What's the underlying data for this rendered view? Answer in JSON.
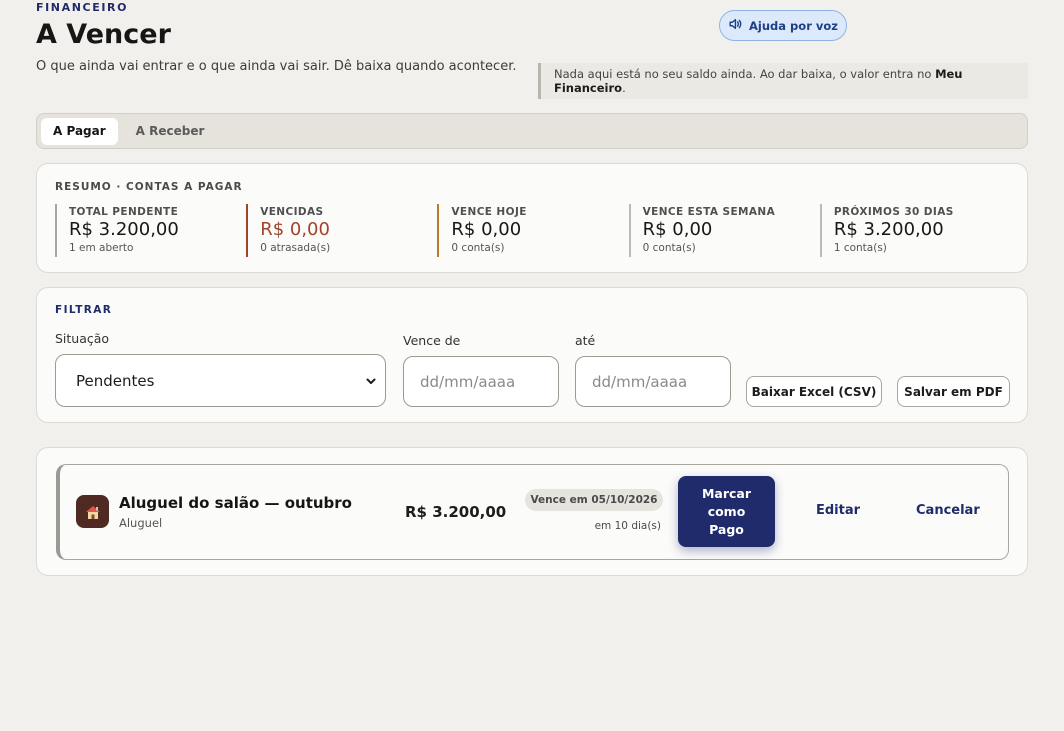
{
  "header": {
    "eyebrow": "FINANCEIRO",
    "title": "A Vencer",
    "subtitle": "O que ainda vai entrar e o que ainda vai sair. Dê baixa quando acontecer.",
    "voice_help_label": "Ajuda por voz",
    "notice_text": "Nada aqui está no seu saldo ainda. Ao dar baixa, o valor entra no ",
    "notice_bold": "Meu Financeiro",
    "notice_end": "."
  },
  "tabs": [
    {
      "label": "A Pagar",
      "active": true
    },
    {
      "label": "A Receber",
      "active": false
    }
  ],
  "summary": {
    "heading": "RESUMO · CONTAS A PAGAR",
    "stats": [
      {
        "label": "TOTAL PENDENTE",
        "value": "R$ 3.200,00",
        "sub": "1 em aberto"
      },
      {
        "label": "VENCIDAS",
        "value": "R$ 0,00",
        "sub": "0 atrasada(s)"
      },
      {
        "label": "VENCE HOJE",
        "value": "R$ 0,00",
        "sub": "0 conta(s)"
      },
      {
        "label": "VENCE ESTA SEMANA",
        "value": "R$ 0,00",
        "sub": "0 conta(s)"
      },
      {
        "label": "PRÓXIMOS 30 DIAS",
        "value": "R$ 3.200,00",
        "sub": "1 conta(s)"
      }
    ]
  },
  "filter": {
    "heading": "FILTRAR",
    "status_label": "Situação",
    "status_value": "Pendentes",
    "from_label": "Vence de",
    "from_placeholder": "dd/mm/aaaa",
    "to_label": "até",
    "to_placeholder": "dd/mm/aaaa",
    "export_csv_label": "Baixar Excel (CSV)",
    "export_pdf_label": "Salvar em PDF"
  },
  "bills": [
    {
      "icon": "house-icon",
      "name": "Aluguel do salão — outubro",
      "category": "Aluguel",
      "amount": "R$ 3.200,00",
      "due_badge": "Vence em 05/10/2026",
      "due_relative": "em 10 dia(s)",
      "pay_label": "Marcar como Pago",
      "edit_label": "Editar",
      "cancel_label": "Cancelar"
    }
  ],
  "colors": {
    "accent": "#1f2b6b",
    "danger": "#a0452c",
    "warning": "#b67c2a",
    "background": "#f2f0ec"
  }
}
